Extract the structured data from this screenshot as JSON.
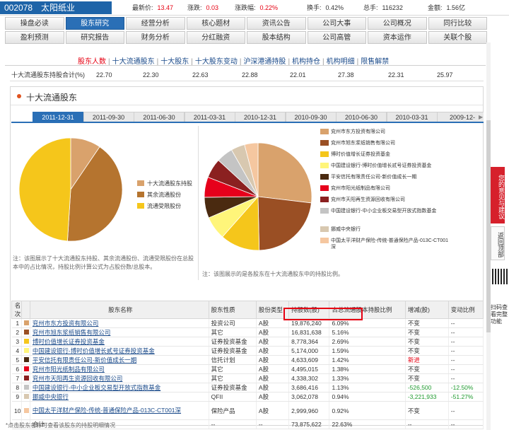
{
  "stock": {
    "code": "002078",
    "name": "太阳纸业"
  },
  "quotes": [
    {
      "label": "最新价:",
      "value": "13.47"
    },
    {
      "label": "涨跌:",
      "value": "0.03"
    },
    {
      "label": "涨跌幅:",
      "value": "0.22%"
    },
    {
      "label": "换手:",
      "value": "0.42%"
    },
    {
      "label": "总手:",
      "value": "116232"
    },
    {
      "label": "金额:",
      "value": "1.56亿"
    }
  ],
  "nav": [
    [
      "操盘必读",
      "股东研究",
      "经营分析",
      "核心题材",
      "资讯公告",
      "公司大事",
      "公司概况",
      "同行比较"
    ],
    [
      "盈利预测",
      "研究报告",
      "财务分析",
      "分红融资",
      "股本结构",
      "公司高管",
      "资本运作",
      "关联个股"
    ]
  ],
  "nav_active": "股东研究",
  "subnav": [
    "股东人数",
    "十大流通股东",
    "十大股东",
    "十大股东变动",
    "沪深港通持股",
    "机构持仓",
    "机构明细",
    "限售解禁"
  ],
  "subnav_current": "股东人数",
  "top_row": {
    "label": "十大流通股东持股合计(%)",
    "values": [
      "22.70",
      "22.30",
      "22.63",
      "22.88",
      "22.01",
      "27.38",
      "22.31",
      "25.97"
    ]
  },
  "section_title": "十大流通股东",
  "date_tabs": [
    "2011-12-31",
    "2011-09-30",
    "2011-06-30",
    "2011-03-31",
    "2010-12-31",
    "2010-09-30",
    "2010-06-30",
    "2010-03-31",
    "2009-12-"
  ],
  "left_pie": {
    "legend": [
      "十大流通股东持股",
      "其余流通股份",
      "流通受限股份"
    ],
    "colors": [
      "#d9a26c",
      "#b5742f",
      "#f5c61b"
    ],
    "values": [
      9.5,
      41.5,
      49.0
    ],
    "note": "注：该图展示了十大流通股东持股、其余流通股份、流通受限股份在总股本中的占比情况，持股比例计算公式为占股份数/总股本。"
  },
  "right_pie": {
    "legend": [
      "兖州市东方投资有限公司",
      "兖州市旭东浆纸销售有限公司",
      "博时价值增长证券投资基金",
      "中国建设银行-博时价值增长贰号证券投资基金",
      "平安信托有限责任公司-新价值成长一期",
      "兖州市阳光纸制品有限公司",
      "兖州市天阳再生资源回收有限公司",
      "中国建设银行-中小企业板交易型开放式指数基金",
      "挪威中央银行",
      "中国太平洋财产保险-传统-普通保险产品-013C-CT001深"
    ],
    "colors": [
      "#d9a26c",
      "#9a4f24",
      "#f5c61b",
      "#fff57a",
      "#4a2a10",
      "#e6001b",
      "#8b2020",
      "#c4c4c4",
      "#d8c8b0",
      "#f5c7a0"
    ],
    "values": [
      6.09,
      5.16,
      2.69,
      1.59,
      1.42,
      1.38,
      1.34,
      1.13,
      0.94,
      0.92
    ],
    "note": "注：该图展示的是各股东在十大流通股东中的持股比例。"
  },
  "table": {
    "headers": [
      "名次",
      "股东名称",
      "股东性质",
      "股份类型",
      "持股数(股)",
      "占总流通股本持股比例",
      "增减(股)",
      "变动比例"
    ],
    "rows": [
      {
        "idx": "1",
        "name": "兖州市东方投资有限公司",
        "nature": "投资公司",
        "type": "A股",
        "shares": "19,876,240",
        "pct": "6.09%",
        "chg": "不变",
        "var": "--"
      },
      {
        "idx": "2",
        "name": "兖州市旭东浆纸销售有限公司",
        "nature": "其它",
        "type": "A股",
        "shares": "16,831,638",
        "pct": "5.16%",
        "chg": "不变",
        "var": "--"
      },
      {
        "idx": "3",
        "name": "博时价值增长证券投资基金",
        "nature": "证券投资基金",
        "type": "A股",
        "shares": "8,778,364",
        "pct": "2.69%",
        "chg": "不变",
        "var": "--"
      },
      {
        "idx": "4",
        "name": "中国建设银行-博时价值增长贰号证券投资基金",
        "nature": "证券投资基金",
        "type": "A股",
        "shares": "5,174,000",
        "pct": "1.59%",
        "chg": "不变",
        "var": "--"
      },
      {
        "idx": "5",
        "name": "平安信托有限责任公司-新价值成长一期",
        "nature": "信托计划",
        "type": "A股",
        "shares": "4,633,609",
        "pct": "1.42%",
        "chg": "新进",
        "var": "--"
      },
      {
        "idx": "6",
        "name": "兖州市阳光纸制品有限公司",
        "nature": "其它",
        "type": "A股",
        "shares": "4,495,015",
        "pct": "1.38%",
        "chg": "不变",
        "var": "--"
      },
      {
        "idx": "7",
        "name": "兖州市天阳再生资源回收有限公司",
        "nature": "其它",
        "type": "A股",
        "shares": "4,338,302",
        "pct": "1.33%",
        "chg": "不变",
        "var": "--"
      },
      {
        "idx": "8",
        "name": "中国建设银行-中小企业板交易型开放式指数基金",
        "nature": "证券投资基金",
        "type": "A股",
        "shares": "3,686,416",
        "pct": "1.13%",
        "chg": "-526,500",
        "var": "-12.50%"
      },
      {
        "idx": "9",
        "name": "挪威中央银行",
        "nature": "QFII",
        "type": "A股",
        "shares": "3,062,078",
        "pct": "0.94%",
        "chg": "-3,221,933",
        "var": "-51.27%"
      },
      {
        "idx": "10",
        "name": "中国太平洋财产保险-传统-普通保险产品-013C-CT001深",
        "nature": "保险产品",
        "type": "A股",
        "shares": "2,999,960",
        "pct": "0.92%",
        "chg": "不变",
        "var": "--"
      }
    ],
    "total": {
      "label": "合计",
      "nature": "--",
      "type": "--",
      "shares": "73,875,622",
      "pct": "22.63%",
      "chg": "--",
      "var": "--"
    }
  },
  "footnote": "*点击股东名称可查看该股东的持股明细情况",
  "side": {
    "feedback": "您的意见与建议",
    "back": "返回顶部",
    "qr": "扫码查看完整功能"
  }
}
